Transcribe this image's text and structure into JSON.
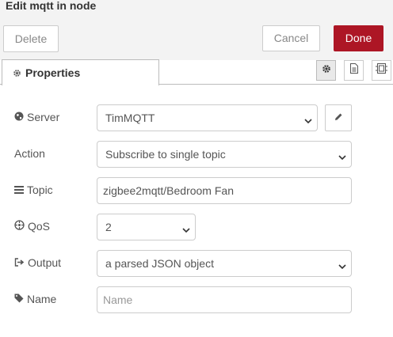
{
  "dialog": {
    "title": "Edit mqtt in node"
  },
  "toolbar": {
    "delete_label": "Delete",
    "cancel_label": "Cancel",
    "done_label": "Done"
  },
  "tabs": {
    "properties_label": "Properties"
  },
  "form": {
    "server": {
      "label": "Server",
      "value": "TimMQTT"
    },
    "action": {
      "label": "Action",
      "value": "Subscribe to single topic"
    },
    "topic": {
      "label": "Topic",
      "value": "zigbee2mqtt/Bedroom Fan"
    },
    "qos": {
      "label": "QoS",
      "value": "2"
    },
    "output": {
      "label": "Output",
      "value": "a parsed JSON object"
    },
    "name": {
      "label": "Name",
      "value": "",
      "placeholder": "Name"
    }
  },
  "colors": {
    "done_bg": "#ad1625",
    "toolbar_bg": "#f3f3f3",
    "border": "#cccccc"
  },
  "icons": [
    "gear-icon",
    "description-icon",
    "appearance-icon",
    "globe-icon",
    "list-icon",
    "qos-icon",
    "output-icon",
    "tag-icon",
    "pencil-icon",
    "chevron-down-icon"
  ]
}
